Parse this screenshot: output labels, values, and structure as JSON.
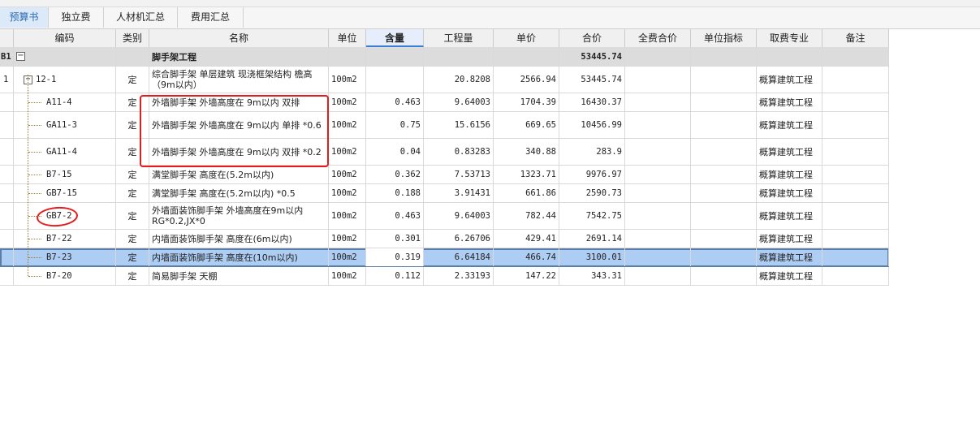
{
  "tabs": [
    "预算书",
    "独立费",
    "人材机汇总",
    "费用汇总"
  ],
  "columns": [
    "编码",
    "类别",
    "名称",
    "单位",
    "含量",
    "工程量",
    "单价",
    "合价",
    "全费合价",
    "单位指标",
    "取费专业",
    "备注"
  ],
  "group": {
    "index": "B1",
    "expander": "−",
    "name": "脚手架工程",
    "total": "53445.74"
  },
  "rows": [
    {
      "index": "1",
      "expander": "−",
      "code": "12-1",
      "type": "定",
      "name": "综合脚手架 单层建筑 现浇框架结构 檐高（9m以内）",
      "unit": "100m2",
      "content": "",
      "qty": "20.8208",
      "price": "2566.94",
      "total": "53445.74",
      "fee": "概算建筑工程"
    },
    {
      "index": "",
      "code": "A11-4",
      "type": "定",
      "name": "外墙脚手架 外墙高度在 9m以内 双排",
      "unit": "100m2",
      "content": "0.463",
      "qty": "9.64003",
      "price": "1704.39",
      "total": "16430.37",
      "fee": "概算建筑工程"
    },
    {
      "index": "",
      "code": "GA11-3",
      "type": "定",
      "name": "外墙脚手架 外墙高度在 9m以内 单排 *0.6",
      "unit": "100m2",
      "content": "0.75",
      "qty": "15.6156",
      "price": "669.65",
      "total": "10456.99",
      "fee": "概算建筑工程"
    },
    {
      "index": "",
      "code": "GA11-4",
      "type": "定",
      "name": "外墙脚手架 外墙高度在 9m以内 双排 *0.2",
      "unit": "100m2",
      "content": "0.04",
      "qty": "0.83283",
      "price": "340.88",
      "total": "283.9",
      "fee": "概算建筑工程"
    },
    {
      "index": "",
      "code": "B7-15",
      "type": "定",
      "name": "满堂脚手架 高度在(5.2m以内)",
      "unit": "100m2",
      "content": "0.362",
      "qty": "7.53713",
      "price": "1323.71",
      "total": "9976.97",
      "fee": "概算建筑工程"
    },
    {
      "index": "",
      "code": "GB7-15",
      "type": "定",
      "name": "满堂脚手架 高度在(5.2m以内) *0.5",
      "unit": "100m2",
      "content": "0.188",
      "qty": "3.91431",
      "price": "661.86",
      "total": "2590.73",
      "fee": "概算建筑工程"
    },
    {
      "index": "",
      "code": "GB7-2",
      "type": "定",
      "name": "外墙面装饰脚手架 外墙高度在9m以内 RG*0.2,JX*0",
      "unit": "100m2",
      "content": "0.463",
      "qty": "9.64003",
      "price": "782.44",
      "total": "7542.75",
      "fee": "概算建筑工程"
    },
    {
      "index": "",
      "code": "B7-22",
      "type": "定",
      "name": "内墙面装饰脚手架 高度在(6m以内)",
      "unit": "100m2",
      "content": "0.301",
      "qty": "6.26706",
      "price": "429.41",
      "total": "2691.14",
      "fee": "概算建筑工程"
    },
    {
      "index": "",
      "code": "B7-23",
      "type": "定",
      "name": "内墙面装饰脚手架 高度在(10m以内)",
      "unit": "100m2",
      "content": "0.319",
      "qty": "6.64184",
      "price": "466.74",
      "total": "3100.01",
      "fee": "概算建筑工程"
    },
    {
      "index": "",
      "code": "B7-20",
      "type": "定",
      "name": "简易脚手架 天棚",
      "unit": "100m2",
      "content": "0.112",
      "qty": "2.33193",
      "price": "147.22",
      "total": "343.31",
      "fee": "概算建筑工程"
    }
  ],
  "colors": {
    "annotation": "#e31c1c",
    "selected_row": "#aecdf3",
    "active_tab": "#dbe9f8",
    "group_row": "#dcdcdc"
  }
}
